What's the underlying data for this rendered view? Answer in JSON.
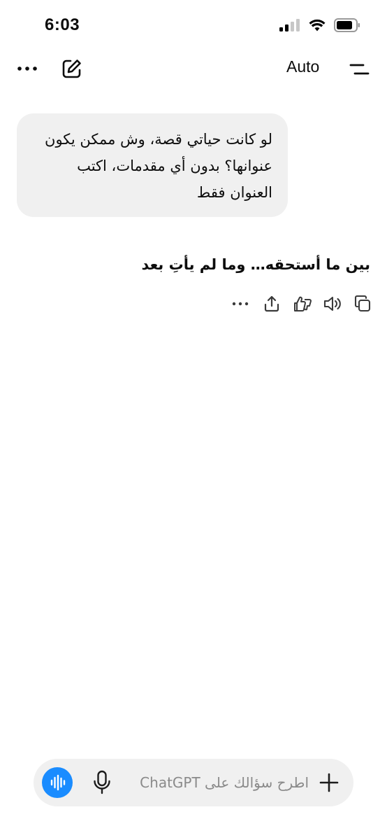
{
  "status_bar": {
    "time": "6:03"
  },
  "nav": {
    "model_label": "Auto",
    "icons": [
      "more-icon",
      "compose-icon",
      "menu-icon"
    ]
  },
  "conversation": {
    "user_message": "لو كانت حياتي قصة، وش ممكن يكون عنوانها؟ بدون أي مقدمات، اكتب العنوان فقط",
    "assistant_message": "بين ما أستحقه… وما لم يأتِ بعد",
    "actions": [
      "more-options-icon",
      "share-icon",
      "feedback-icon",
      "read-aloud-icon",
      "copy-icon"
    ]
  },
  "composer": {
    "placeholder": "اطرح سؤالك على ChatGPT",
    "value": "",
    "accent_color": "#1a8cff"
  }
}
